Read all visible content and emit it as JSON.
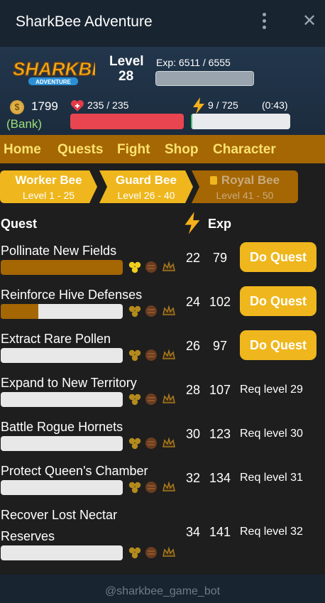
{
  "window": {
    "title": "SharkBee Adventure"
  },
  "header": {
    "logo_text": "SHARKBEE",
    "logo_sub": "ADVENTURE",
    "level_label": "Level",
    "level": "28",
    "exp_text": "Exp: 6511 / 6555",
    "exp_fraction": 0.993,
    "gold": "1799",
    "bank": "(Bank)",
    "hp_text": "235 / 235",
    "hp_fraction": 1.0,
    "energy_text": "9 / 725",
    "energy_timer": "(0:43)",
    "energy_fraction": 0.012
  },
  "nav": {
    "items": [
      "Home",
      "Quests",
      "Fight",
      "Shop",
      "Character"
    ]
  },
  "tiers": [
    {
      "name": "Worker Bee",
      "range": "Level 1 - 25"
    },
    {
      "name": "Guard Bee",
      "range": "Level 26 - 40"
    },
    {
      "name": "Royal Bee",
      "range": "Level 41 - 50"
    }
  ],
  "table": {
    "quest_header": "Quest",
    "exp_header": "Exp"
  },
  "quests": [
    {
      "name": "Pollinate New Fields",
      "energy": "22",
      "exp": "79",
      "action": "Do Quest",
      "progress": 1.0,
      "honeycomb_active": true
    },
    {
      "name": "Reinforce Hive Defenses",
      "energy": "24",
      "exp": "102",
      "action": "Do Quest",
      "progress": 0.31,
      "honeycomb_active": false
    },
    {
      "name": "Extract Rare Pollen",
      "energy": "26",
      "exp": "97",
      "action": "Do Quest",
      "progress": 0,
      "honeycomb_active": false
    },
    {
      "name": "Expand to New Territory",
      "energy": "28",
      "exp": "107",
      "req": "Req level 29",
      "progress": 0
    },
    {
      "name": "Battle Rogue Hornets",
      "energy": "30",
      "exp": "123",
      "req": "Req level 30",
      "progress": 0
    },
    {
      "name": "Protect Queen's Chamber",
      "energy": "32",
      "exp": "134",
      "req": "Req level 31",
      "progress": 0
    },
    {
      "name_line1": "Recover Lost Nectar",
      "name_line2": "Reserves",
      "energy": "34",
      "exp": "141",
      "req": "Req level 32",
      "progress": 0
    }
  ],
  "footer": {
    "handle": "@sharkbee_game_bot"
  },
  "colors": {
    "accent": "#efb71d",
    "nav": "#a56604",
    "hp": "#e84550",
    "energy": "#3ec46d",
    "bank": "#9be07a"
  }
}
